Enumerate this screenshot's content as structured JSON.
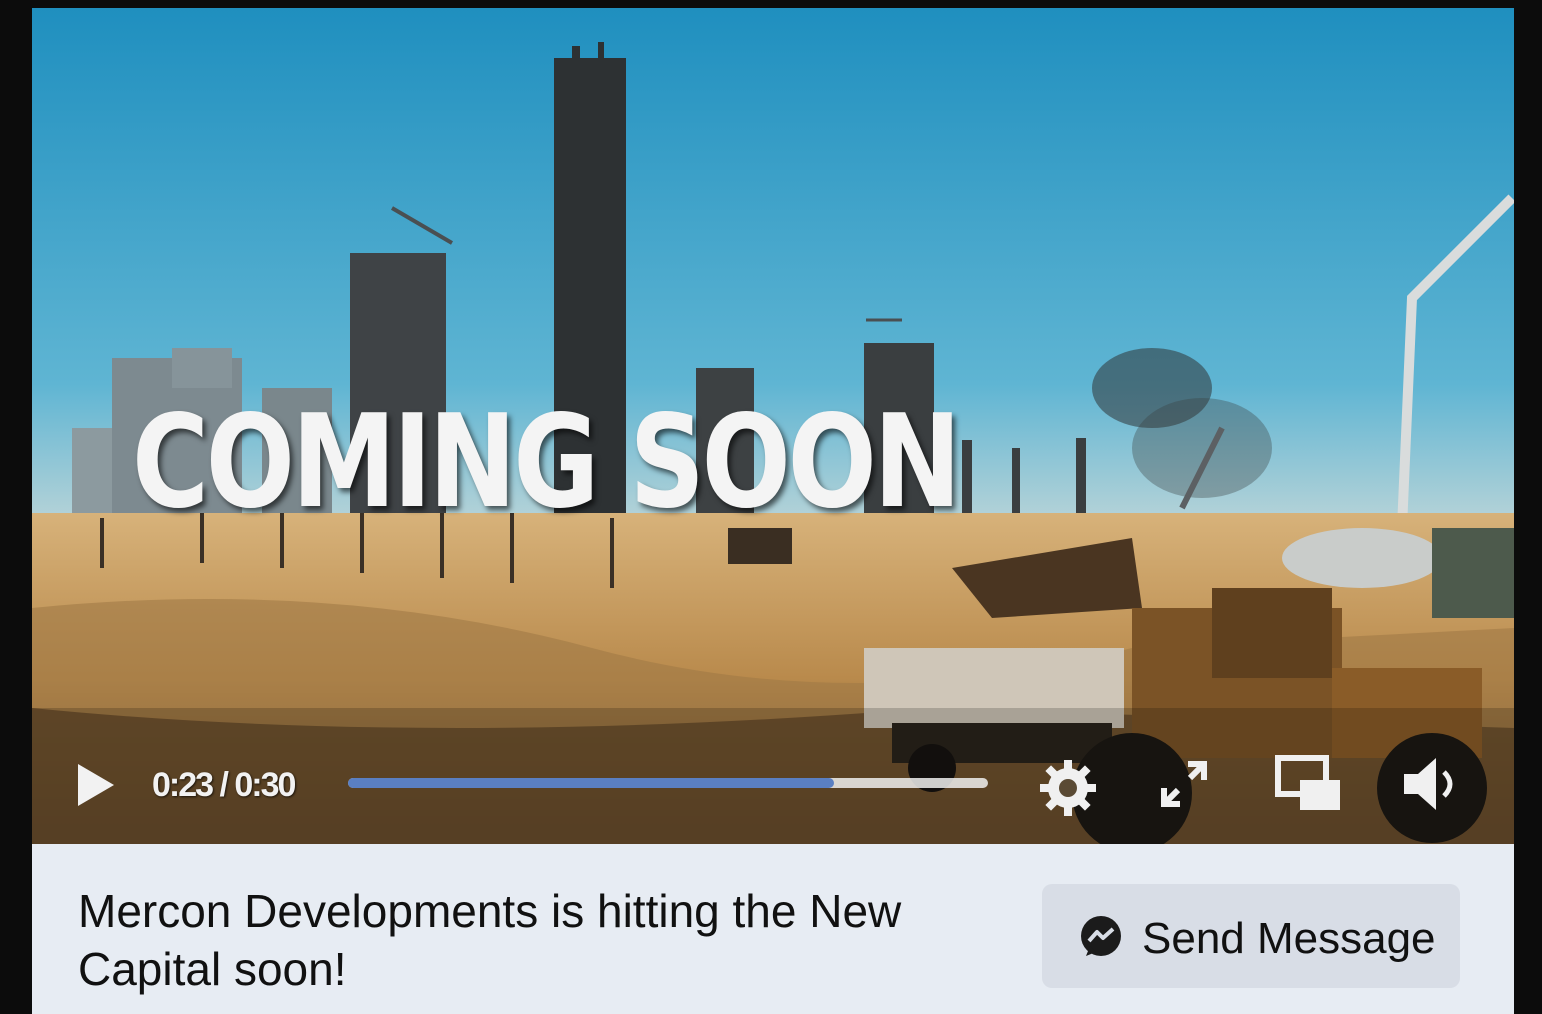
{
  "video": {
    "overlay_text": "COMING SOON",
    "time_display": "0:23 / 0:30",
    "progress_fraction": 0.76,
    "play_icon": "play-icon",
    "settings_icon": "gear-icon",
    "fullscreen_icon": "fullscreen-icon",
    "pip_icon": "picture-in-picture-icon",
    "volume_icon": "volume-icon"
  },
  "footer": {
    "headline": "Mercon Developments is hitting the New Capital soon!",
    "cta_label": "Send Message",
    "cta_icon": "messenger-icon"
  },
  "colors": {
    "progress_fill": "#5a7fc2",
    "footer_bg": "#e7ecf3",
    "button_bg": "#d8dde6"
  }
}
